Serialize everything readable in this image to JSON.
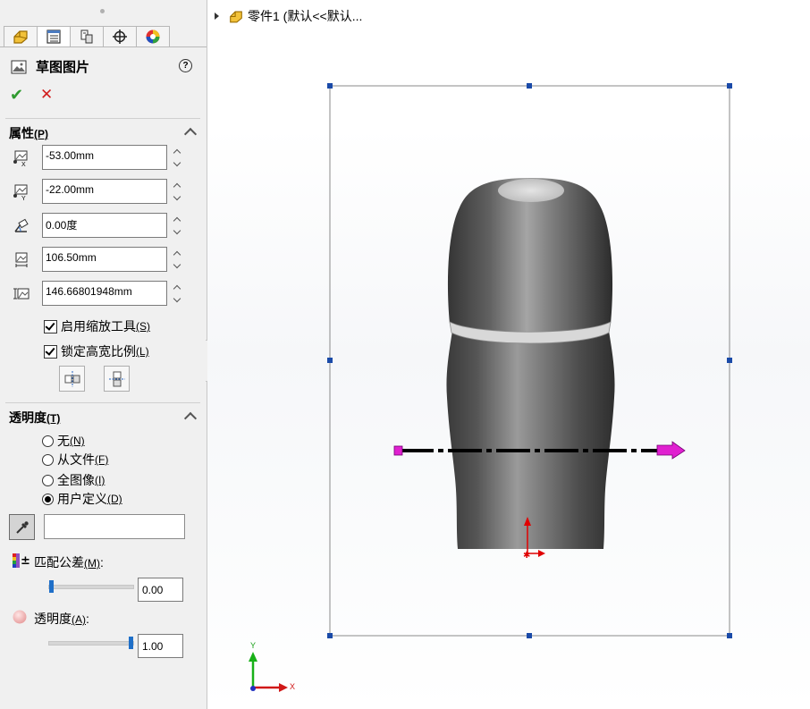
{
  "panel": {
    "title": "草图图片",
    "help": "?",
    "ok": "✔",
    "cancel": "✕",
    "properties": {
      "header": "属性",
      "header_key": "(P)",
      "fields": [
        {
          "name": "origin-x",
          "value": "-53.00mm"
        },
        {
          "name": "origin-y",
          "value": "-22.00mm"
        },
        {
          "name": "angle",
          "value": "0.00度"
        },
        {
          "name": "width",
          "value": "106.50mm"
        },
        {
          "name": "height",
          "value": "146.66801948mm"
        }
      ],
      "enable_scale": "启用缩放工具",
      "enable_scale_key": "(S)",
      "lock_ratio": "锁定高宽比例",
      "lock_ratio_key": "(L)"
    },
    "transparency": {
      "header": "透明度",
      "header_key": "(T)",
      "options": [
        {
          "label": "无",
          "key": "(N)",
          "selected": false
        },
        {
          "label": "从文件",
          "key": "(F)",
          "selected": false
        },
        {
          "label": "全图像",
          "key": "(I)",
          "selected": false
        },
        {
          "label": "用户定义",
          "key": "(D)",
          "selected": true
        }
      ],
      "color_value": "",
      "match_tolerance_label": "匹配公差",
      "match_tolerance_key": "(M)",
      "match_tolerance_colon": ":",
      "match_tolerance_value": "0.00",
      "match_tolerance_level": 0.0,
      "transparency_label": "透明度",
      "transparency_key": "(A)",
      "transparency_colon": ":",
      "transparency_value": "1.00",
      "transparency_level": 1.0
    }
  },
  "viewport": {
    "tree_label": "零件1 (默认<<默认..."
  },
  "triad": {
    "x": "X",
    "y": "Y"
  },
  "colors": {
    "check_green": "#2e9a2e",
    "cancel_red": "#d21e1e",
    "slider_blue": "#1f6fc8",
    "handle_blue": "#1a4aa8",
    "arrow_magenta": "#e020d0"
  }
}
